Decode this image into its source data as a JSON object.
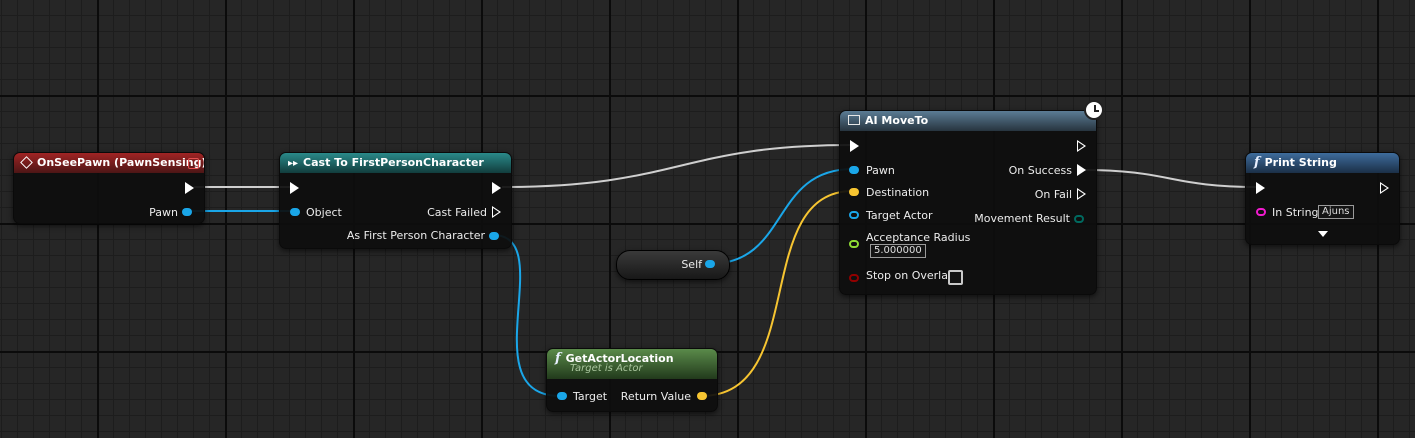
{
  "nodes": {
    "on_see_pawn": {
      "title": "OnSeePawn (PawnSensing)",
      "pins": {
        "pawn": "Pawn"
      }
    },
    "cast": {
      "title": "Cast To FirstPersonCharacter",
      "pins": {
        "object": "Object",
        "cast_failed": "Cast Failed",
        "as_fpc": "As First Person Character"
      }
    },
    "self_node": {
      "label": "Self"
    },
    "get_actor_location": {
      "title": "GetActorLocation",
      "subtitle": "Target is Actor",
      "pins": {
        "target": "Target",
        "return_value": "Return Value"
      }
    },
    "ai_move_to": {
      "title": "AI MoveTo",
      "pins": {
        "pawn": "Pawn",
        "destination": "Destination",
        "target_actor": "Target Actor",
        "acceptance_radius": "Acceptance Radius",
        "acceptance_radius_value": "5.000000",
        "stop_on_overlap": "Stop on Overlap",
        "on_success": "On Success",
        "on_fail": "On Fail",
        "movement_result": "Movement Result"
      }
    },
    "print_string": {
      "title": "Print String",
      "pins": {
        "in_string": "In String",
        "in_string_value": "Ajuns"
      }
    }
  },
  "colors": {
    "object_pin": "#1aa6e8",
    "vector_pin": "#f7c531",
    "float_pin": "#8fdc34",
    "string_pin": "#f01bcd",
    "bool_pin": "#910000",
    "enum_pin": "#00695f",
    "exec_wire": "#cfcfcf"
  }
}
